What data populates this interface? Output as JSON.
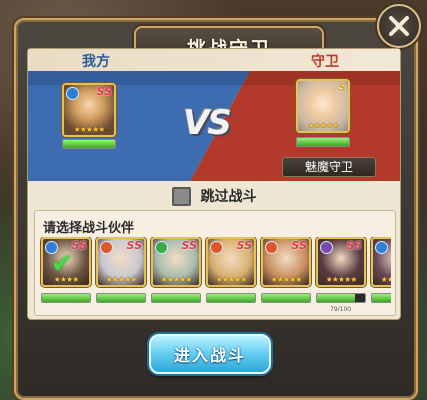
{
  "dialog": {
    "title": "挑战守卫",
    "close_icon": "close-icon"
  },
  "battle": {
    "our_side_label": "我方",
    "enemy_side_label": "守卫",
    "vs_text": "VS",
    "our_hero": {
      "rank": "SS",
      "stars": "★★★★★",
      "element": "water",
      "hp_fraction": 1.0
    },
    "guard_hero": {
      "rank": "S",
      "stars": "★★★★★",
      "element": "light",
      "hp_fraction": 1.0,
      "name": "魅魔守卫"
    },
    "colors": {
      "our_side": "#3d6cb0",
      "enemy_side": "#b33a2a"
    }
  },
  "skip": {
    "label": "跳过战斗",
    "checked": false
  },
  "partners": {
    "title": "请选择战斗伙伴",
    "items": [
      {
        "rank": "SS",
        "stars": "★★★★",
        "element": "water",
        "selected": true,
        "hp_fraction": 1.0,
        "tone": "#6b5443"
      },
      {
        "rank": "SS",
        "stars": "★★★★★",
        "element": "fire",
        "selected": false,
        "hp_fraction": 1.0,
        "tone": "#c8c8d0"
      },
      {
        "rank": "SS",
        "stars": "★★★★★",
        "element": "wind",
        "selected": false,
        "hp_fraction": 1.0,
        "tone": "#a8bcb0"
      },
      {
        "rank": "SS",
        "stars": "★★★★★",
        "element": "fire",
        "selected": false,
        "hp_fraction": 1.0,
        "tone": "#d8b070"
      },
      {
        "rank": "SS",
        "stars": "★★★★★",
        "element": "fire",
        "selected": false,
        "hp_fraction": 1.0,
        "tone": "#c89060"
      },
      {
        "rank": "SS",
        "stars": "★★★★★",
        "element": "dark",
        "selected": false,
        "hp_fraction": 0.79,
        "tone": "#5a3a40",
        "hp_text": "79/100"
      },
      {
        "rank": "S",
        "stars": "★★★★★",
        "element": "water",
        "selected": false,
        "hp_fraction": 1.0,
        "tone": "#6a4a5a"
      }
    ]
  },
  "enter_button": {
    "label": "进入战斗"
  }
}
